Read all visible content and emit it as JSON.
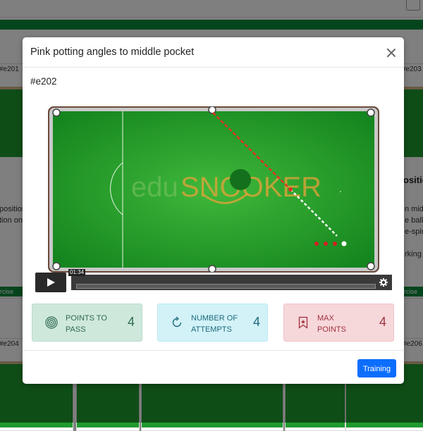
{
  "background": {
    "cards": [
      {
        "code": "#e201",
        "partial_lines": [
          "position",
          "tion on"
        ],
        "footer": "ercise"
      },
      {
        "code": "#e203",
        "heading": "ositio",
        "partial_lines": [
          "n mido",
          "e ball i",
          "e-spin",
          "rking"
        ],
        "footer": "ercise"
      },
      {
        "code": "#e204"
      },
      {
        "code": "#e206"
      }
    ]
  },
  "modal": {
    "title": "Pink potting angles to middle pocket",
    "exercise_code": "#e202",
    "video": {
      "logo_text_left": "edu",
      "logo_text_right": "SNOOKER",
      "time": "01:34"
    },
    "stats": [
      {
        "label": "Points to pass",
        "value": "4",
        "icon": "target-icon"
      },
      {
        "label": "Number of attempts",
        "value": "4",
        "icon": "refresh-icon"
      },
      {
        "label": "Max points",
        "value": "4",
        "icon": "bookmark-icon"
      }
    ],
    "footer": {
      "training_label": "Training"
    },
    "colors": {
      "primary": "#0d6efd",
      "success_bg": "#cfe8dc",
      "info_bg": "#d2f2f8",
      "danger_bg": "#f6d7da",
      "table_green": "#1f9a2e"
    }
  }
}
